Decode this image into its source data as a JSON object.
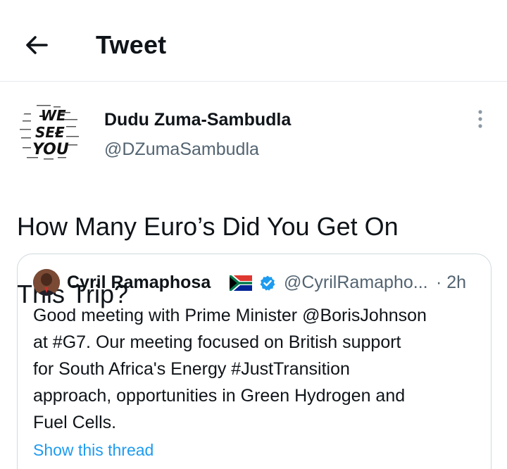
{
  "header": {
    "title": "Tweet",
    "back_icon": "arrow-left-icon"
  },
  "tweet": {
    "author": {
      "name": "Dudu Zuma-Sambudla",
      "handle": "@DZumaSambudla",
      "avatar_text": [
        "WE",
        "SEE",
        "YOU"
      ]
    },
    "text_lines": [
      "How Many Euro’s Did You Get On",
      "This Trip?"
    ],
    "more_icon": "more-vertical-icon"
  },
  "quoted_tweet": {
    "author": {
      "name": "Cyril Ramaphosa",
      "flag": "south-africa-flag-icon",
      "verified_icon": "verified-badge-icon",
      "handle": "@CyrilRamapho...",
      "time": "· 2h"
    },
    "body_lines": [
      "Good meeting with Prime Minister @BorisJohnson",
      "at #G7. Our meeting focused on British support",
      "for South Africa's Energy #JustTransition",
      "approach, opportunities in Green Hydrogen and",
      "Fuel Cells."
    ],
    "show_thread": "Show this thread"
  },
  "colors": {
    "text": "#0f1419",
    "secondary": "#536471",
    "link": "#1d9bf0",
    "divider": "#e6ecf0",
    "verified": "#1d9bf0"
  }
}
